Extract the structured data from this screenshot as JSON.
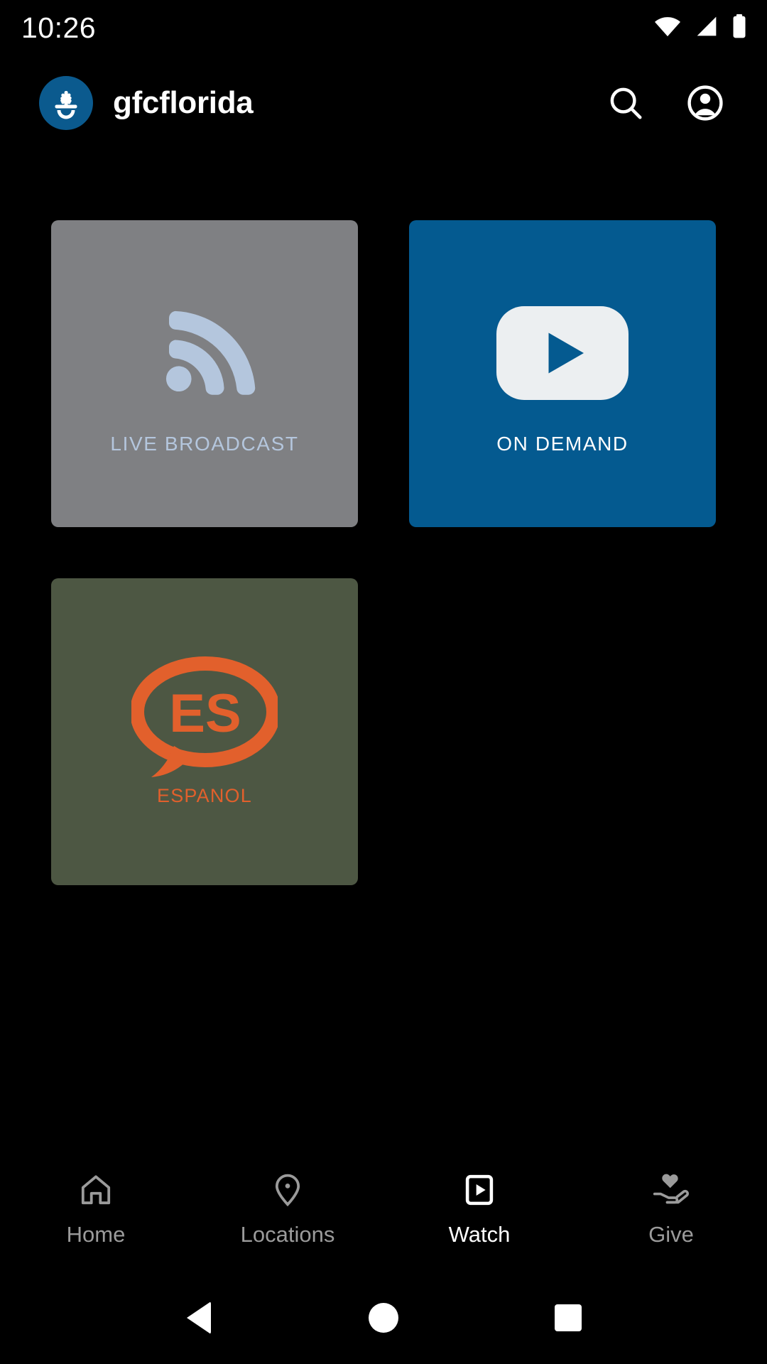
{
  "status_bar": {
    "time": "10:26",
    "icons": [
      "wifi-icon",
      "cellular-signal-icon",
      "battery-icon"
    ]
  },
  "header": {
    "app_name": "gfcflorida",
    "logo_icon": "gfc-sunburst-logo",
    "logo_bg": "#0b5a8e",
    "actions": [
      {
        "name": "search-icon",
        "label": "Search"
      },
      {
        "name": "account-circle-icon",
        "label": "Account"
      }
    ]
  },
  "main": {
    "tiles": [
      {
        "id": "live-broadcast",
        "label": "LIVE BROADCAST",
        "icon": "rss-broadcast-icon",
        "bg_color": "#7f8083",
        "fg_color": "#b4c6dd"
      },
      {
        "id": "on-demand",
        "label": "ON DEMAND",
        "icon": "youtube-play-icon",
        "bg_color": "#045a90",
        "fg_color": "#eceff1"
      },
      {
        "id": "espanol",
        "label": "ESPANOL",
        "icon": "es-speech-bubble-icon",
        "icon_text": "ES",
        "bg_color": "#4d5743",
        "fg_color": "#e2602c"
      }
    ]
  },
  "tab_bar": {
    "items": [
      {
        "id": "home",
        "label": "Home",
        "icon": "home-icon",
        "active": false,
        "color": "#9b9b9b"
      },
      {
        "id": "locations",
        "label": "Locations",
        "icon": "location-pin-icon",
        "active": false,
        "color": "#9b9b9b"
      },
      {
        "id": "watch",
        "label": "Watch",
        "icon": "play-box-icon",
        "active": true,
        "color": "#ffffff"
      },
      {
        "id": "give",
        "label": "Give",
        "icon": "hand-heart-icon",
        "active": false,
        "color": "#9b9b9b"
      }
    ]
  },
  "system_nav": {
    "buttons": [
      {
        "id": "back",
        "icon": "triangle-back-icon"
      },
      {
        "id": "home",
        "icon": "circle-home-icon"
      },
      {
        "id": "recent",
        "icon": "square-recents-icon"
      }
    ]
  }
}
